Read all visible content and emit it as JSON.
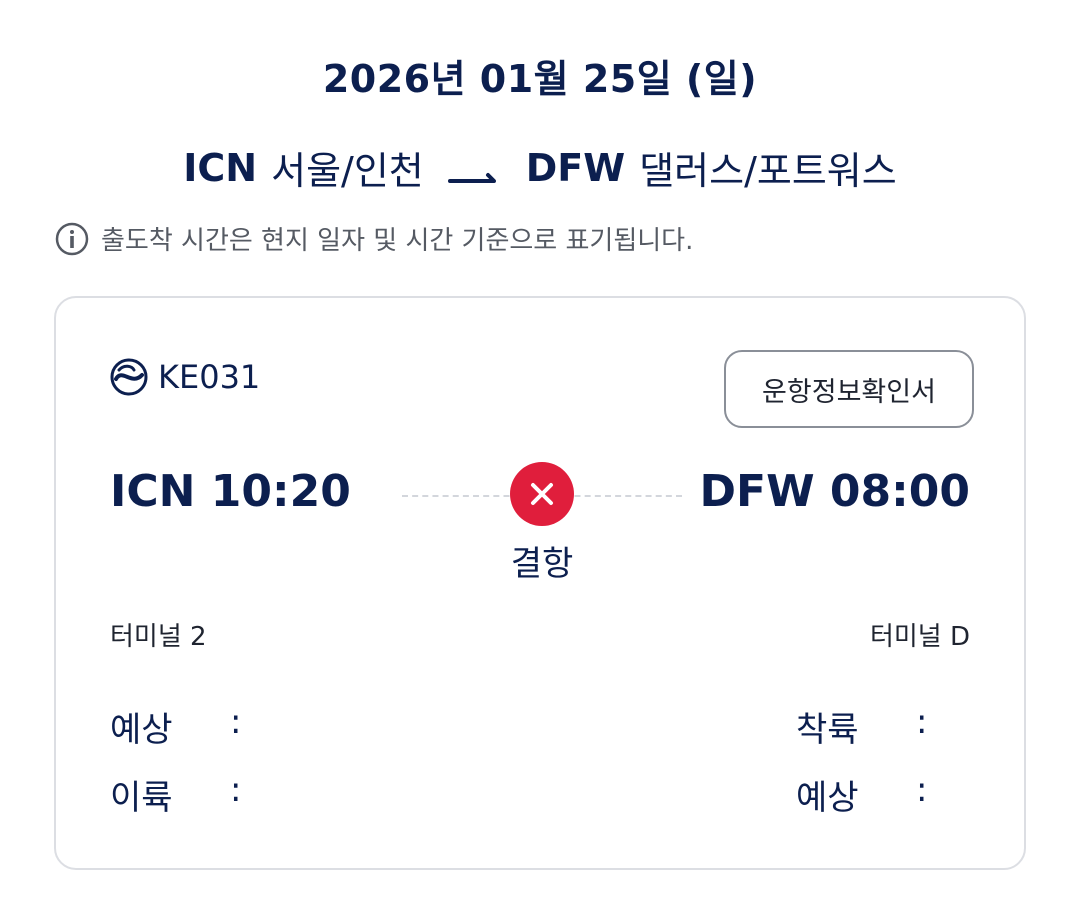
{
  "header": {
    "date": "2026년 01월 25일 (일)",
    "origin_code": "ICN",
    "origin_city": "서울/인천",
    "destination_code": "DFW",
    "destination_city": "댈러스/포트워스",
    "arrow_icon": "plane-arrow-icon"
  },
  "notice": {
    "icon": "info-icon",
    "text": "출도착 시간은 현지 일자 및 시간 기준으로 표기됩니다."
  },
  "flight": {
    "airline_logo": "korean-air-logo-icon",
    "flight_number": "KE031",
    "confirm_button_label": "운항정보확인서",
    "departure_label": "ICN 10:20",
    "arrival_label": "DFW 08:00",
    "status_icon": "cancelled-x-icon",
    "status_text": "결항",
    "status_color": "#e01e3c",
    "departure_terminal": "터미널 2",
    "arrival_terminal": "터미널 D",
    "departure_rows": [
      {
        "label": "예상",
        "separator": ":",
        "value": ""
      },
      {
        "label": "이륙",
        "separator": ":",
        "value": ""
      }
    ],
    "arrival_rows": [
      {
        "label": "착륙",
        "separator": ":",
        "value": ""
      },
      {
        "label": "예상",
        "separator": ":",
        "value": ""
      }
    ]
  },
  "colors": {
    "navy": "#0c1f4f",
    "cancel_red": "#e01e3c",
    "border": "#dcdee3"
  }
}
